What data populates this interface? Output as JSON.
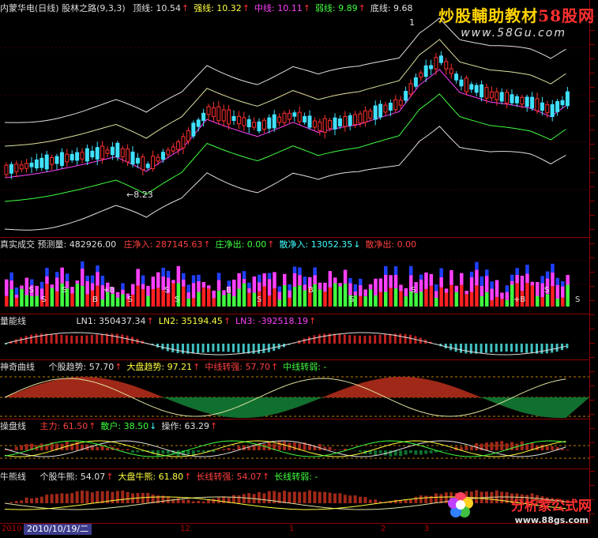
{
  "main": {
    "title": "内蒙华电(日线) 股林之路(9,3,3)",
    "items": [
      {
        "label": "顶线: 10.54",
        "arrow": "↑",
        "color": "#e0e0e0"
      },
      {
        "label": "强线: 10.32",
        "arrow": "↑",
        "color": "#ffff40"
      },
      {
        "label": "中线: 10.11",
        "arrow": "↑",
        "color": "#ff40ff"
      },
      {
        "label": "弱线: 9.89",
        "arrow": "↑",
        "color": "#40ff40"
      },
      {
        "label": "底线: 9.68",
        "arrow": "",
        "color": "#e0e0e0"
      }
    ],
    "low_label": "←8.23",
    "high_label": "1"
  },
  "volume": {
    "title": "真实成交 预测量: 482926.00",
    "items": [
      {
        "label": "庄净入: 287145.63",
        "arrow": "↑",
        "color": "#ff4040"
      },
      {
        "label": "庄净出: 0.00",
        "arrow": "↑",
        "color": "#40ff40"
      },
      {
        "label": "散净入: 13052.35",
        "arrow": "↓",
        "color": "#40ffff"
      },
      {
        "label": "散净出: 0.00",
        "arrow": "",
        "color": "#ff4040"
      }
    ],
    "signals": [
      "S",
      "S",
      "S",
      "B",
      "+B",
      "S",
      "S",
      "S",
      "B",
      "S",
      "B",
      "S",
      "S",
      "+B",
      "S",
      "S"
    ]
  },
  "energy": {
    "title": "量能线",
    "items": [
      {
        "label": "LN1: 350437.34",
        "arrow": "↑",
        "color": "#e0e0e0"
      },
      {
        "label": "LN2: 35194.45",
        "arrow": "↑",
        "color": "#ffff40"
      },
      {
        "label": "LN3: -392518.19",
        "arrow": "↑",
        "color": "#ff40ff"
      }
    ]
  },
  "curve": {
    "title": "神奇曲线",
    "items": [
      {
        "label": "个股趋势: 57.70",
        "arrow": "↑",
        "color": "#e0e0e0"
      },
      {
        "label": "大盘趋势: 97.21",
        "arrow": "↑",
        "color": "#ffff40"
      },
      {
        "label": "中线转强: 57.70",
        "arrow": "↑",
        "color": "#ff4040"
      },
      {
        "label": "中线转弱: -",
        "arrow": "",
        "color": "#40ff40"
      }
    ]
  },
  "trade": {
    "title": "操盘线",
    "items": [
      {
        "label": "主力: 61.50",
        "arrow": "↑",
        "color": "#ff4040"
      },
      {
        "label": "散户: 38.50",
        "arrow": "↓",
        "color": "#40ff40"
      },
      {
        "label": "操作: 63.29",
        "arrow": "↑",
        "color": "#e0e0e0"
      }
    ]
  },
  "bull": {
    "title": "牛熊线",
    "items": [
      {
        "label": "个股牛熊: 54.07",
        "arrow": "↑",
        "color": "#e0e0e0"
      },
      {
        "label": "大盘牛熊: 61.80",
        "arrow": "↑",
        "color": "#ffff40"
      },
      {
        "label": "长线转强: 54.07",
        "arrow": "↑",
        "color": "#ff4040"
      },
      {
        "label": "长线转弱: -",
        "arrow": "",
        "color": "#40ff40"
      }
    ]
  },
  "watermark_top": {
    "text_a": "炒股輔助教材",
    "text_b": "58股网",
    "url": "www.58Gu.com"
  },
  "watermark_bottom": {
    "text": "分析家公式网",
    "url": "www.88gs.com"
  },
  "date_axis": {
    "selected": "2010/10/19/二",
    "prefix": "2010",
    "labels": [
      "12",
      "1",
      "2",
      "3"
    ]
  },
  "colors": {
    "up": "#ff3030",
    "down": "#40e0ff",
    "grid": "#8b0000",
    "bg": "#000000"
  }
}
